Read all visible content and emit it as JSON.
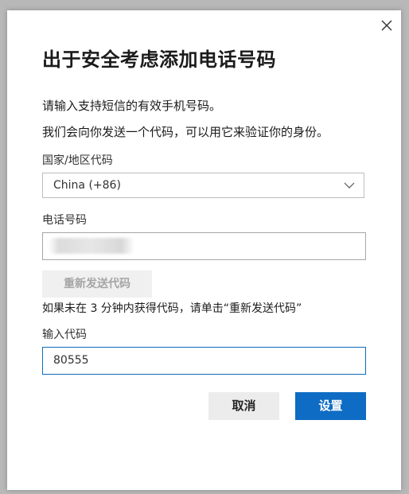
{
  "dialog": {
    "title": "出于安全考虑添加电话号码",
    "description_line1": "请输入支持短信的有效手机号码。",
    "description_line2": "我们会向你发送一个代码，可以用它来验证你的身份。",
    "close_icon": "close-icon"
  },
  "country": {
    "label": "国家/地区代码",
    "selected": "China (+86)",
    "chevron_icon": "chevron-down-icon"
  },
  "phone": {
    "label": "电话号码"
  },
  "resend": {
    "label": "重新发送代码",
    "hint": "如果未在 3 分钟内获得代码，请单击“重新发送代码”"
  },
  "code": {
    "label": "输入代码",
    "value": "80555"
  },
  "actions": {
    "cancel_label": "取消",
    "submit_label": "设置"
  },
  "colors": {
    "primary": "#0e6cc4",
    "focus_border": "#0f6cbd"
  }
}
